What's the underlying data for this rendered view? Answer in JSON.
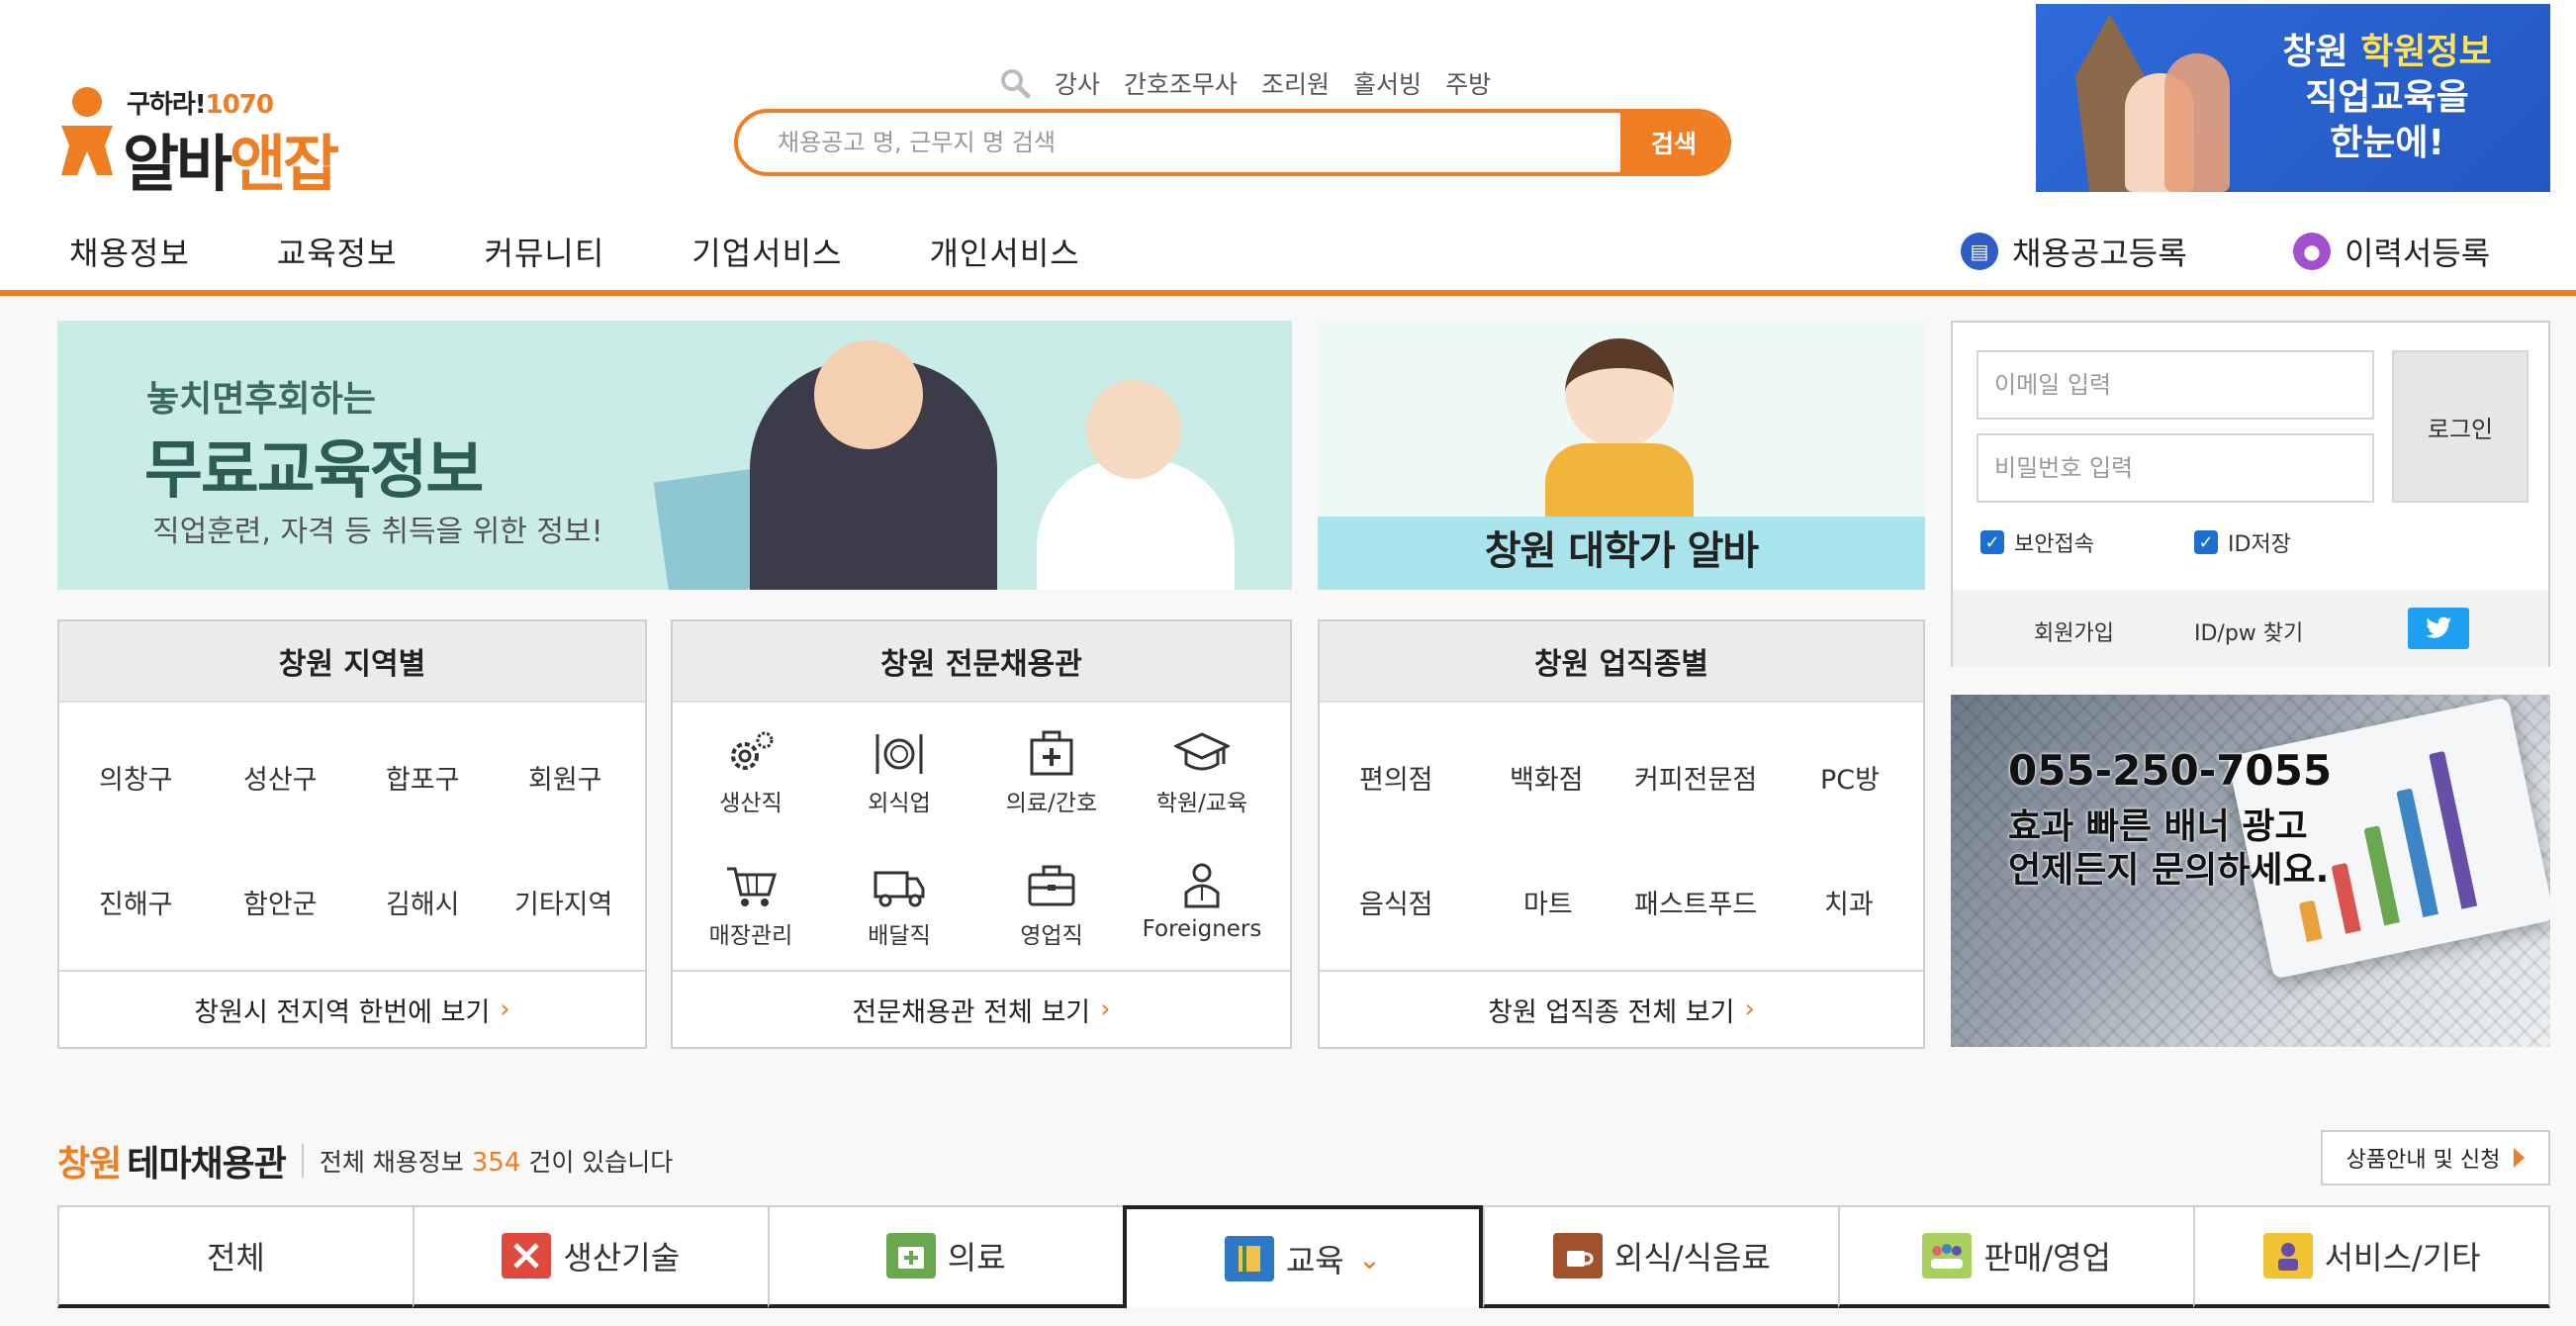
{
  "logo": {
    "tagline": "구하라!",
    "number": "1070",
    "name_part1": "알바",
    "name_part2": "앤잡"
  },
  "search": {
    "popular": [
      "강사",
      "간호조무사",
      "조리원",
      "홀서빙",
      "주방"
    ],
    "placeholder": "채용공고 명, 근무지 명 검색",
    "button": "검색"
  },
  "top_banner": {
    "line1_a": "창원 ",
    "line1_b": "학원정보",
    "line2": "직업교육을",
    "line3": "한눈에!"
  },
  "nav": {
    "items": [
      "채용정보",
      "교육정보",
      "커뮤니티",
      "기업서비스",
      "개인서비스"
    ],
    "post_job": "채용공고등록",
    "post_resume": "이력서등록"
  },
  "edu_banner": {
    "small": "놓치면후회하는",
    "big": "무료교육정보",
    "sub": "직업훈련, 자격 등 취득을 위한 정보!"
  },
  "alba_banner": {
    "text": "창원 대학가 알바"
  },
  "login": {
    "email_placeholder": "이메일 입력",
    "password_placeholder": "비밀번호 입력",
    "button": "로그인",
    "secure": "보안접속",
    "save_id": "ID저장",
    "signup": "회원가입",
    "find": "ID/pw 찾기"
  },
  "ad": {
    "phone": "055-250-7055",
    "line2": "효과 빠른 배너 광고",
    "line3": "언제든지 문의하세요."
  },
  "region_panel": {
    "title": "창원 지역별",
    "rows": [
      [
        "의창구",
        "성산구",
        "합포구",
        "회원구"
      ],
      [
        "진해구",
        "함안군",
        "김해시",
        "기타지역"
      ]
    ],
    "footer": "창원시 전지역 한번에 보기"
  },
  "special_panel": {
    "title": "창원 전문채용관",
    "items": [
      {
        "label": "생산직",
        "icon": "gears-icon"
      },
      {
        "label": "외식업",
        "icon": "dining-icon"
      },
      {
        "label": "의료/간호",
        "icon": "medical-kit-icon"
      },
      {
        "label": "학원/교육",
        "icon": "graduation-cap-icon"
      },
      {
        "label": "매장관리",
        "icon": "cart-icon"
      },
      {
        "label": "배달직",
        "icon": "truck-icon"
      },
      {
        "label": "영업직",
        "icon": "briefcase-icon"
      },
      {
        "label": "Foreigners",
        "icon": "person-icon"
      }
    ],
    "footer": "전문채용관 전체 보기"
  },
  "job_panel": {
    "title": "창원 업직종별",
    "rows": [
      [
        "편의점",
        "백화점",
        "커피전문점",
        "PC방"
      ],
      [
        "음식점",
        "마트",
        "패스트푸드",
        "치과"
      ]
    ],
    "footer": "창원 업직종 전체 보기"
  },
  "theme": {
    "title_part1": "창원",
    "title_part2": "테마채용관",
    "count_prefix": "전체 채용정보",
    "count": "354",
    "count_suffix": "건이 있습니다",
    "product_btn": "상품안내 및 신청",
    "tabs": [
      "전체",
      "생산기술",
      "의료",
      "교육",
      "외식/식음료",
      "판매/영업",
      "서비스/기타"
    ]
  },
  "colors": {
    "accent": "#ef7d21",
    "twitter": "#1ea1f2",
    "checkbox": "#1a6fd1"
  }
}
